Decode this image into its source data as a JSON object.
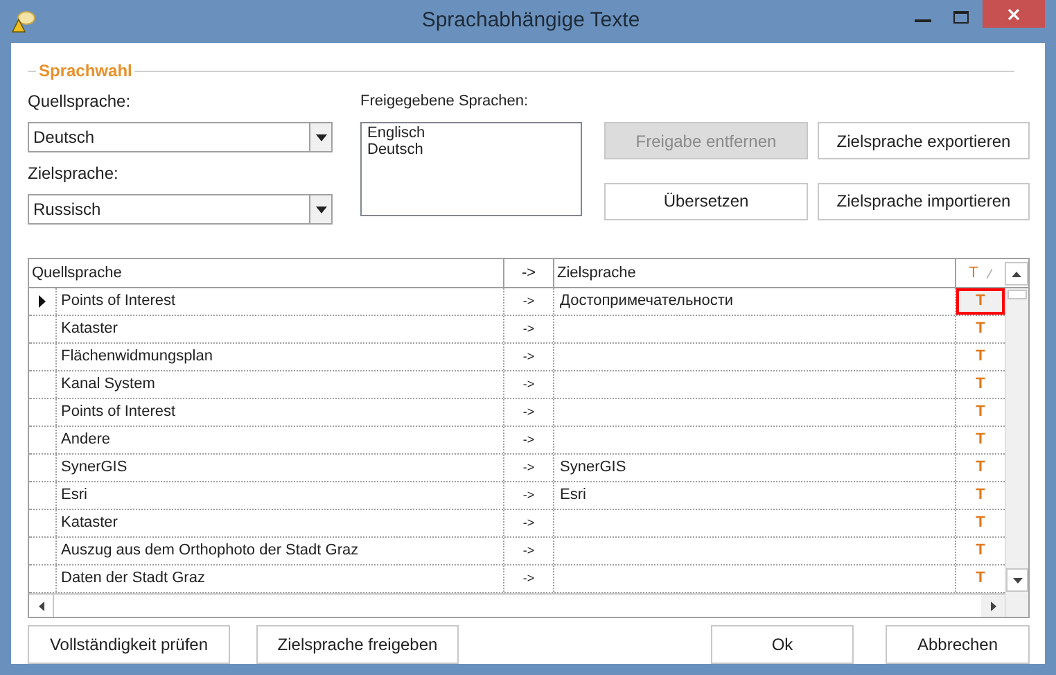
{
  "window": {
    "title": "Sprachabhängige Texte"
  },
  "group": {
    "title": "Sprachwahl"
  },
  "source_language": {
    "label": "Quellsprache:",
    "value": "Deutsch"
  },
  "target_language": {
    "label": "Zielsprache:",
    "value": "Russisch"
  },
  "released_languages": {
    "label": "Freigegebene Sprachen:",
    "items": [
      "Englisch",
      "Deutsch"
    ]
  },
  "action_buttons": [
    {
      "label": "Freigabe entfernen",
      "disabled": true
    },
    {
      "label": "Zielsprache exportieren",
      "disabled": false
    },
    {
      "label": "Übersetzen",
      "disabled": false
    },
    {
      "label": "Zielsprache importieren",
      "disabled": false
    }
  ],
  "table": {
    "columns": [
      "Quellsprache",
      "->",
      "Zielsprache",
      "T"
    ],
    "rows": [
      {
        "source": "Points of Interest",
        "arrow": "->",
        "target": "Достопримечательности",
        "t": "T",
        "selected": true
      },
      {
        "source": "Kataster",
        "arrow": "->",
        "target": "",
        "t": "T",
        "selected": false
      },
      {
        "source": "Flächenwidmungsplan",
        "arrow": "->",
        "target": "",
        "t": "T",
        "selected": false
      },
      {
        "source": "Kanal System",
        "arrow": "->",
        "target": "",
        "t": "T",
        "selected": false
      },
      {
        "source": "Points of Interest",
        "arrow": "->",
        "target": "",
        "t": "T",
        "selected": false
      },
      {
        "source": "Andere",
        "arrow": "->",
        "target": "",
        "t": "T",
        "selected": false
      },
      {
        "source": "SynerGIS",
        "arrow": "->",
        "target": "SynerGIS",
        "t": "T",
        "selected": false
      },
      {
        "source": "Esri",
        "arrow": "->",
        "target": "Esri",
        "t": "T",
        "selected": false
      },
      {
        "source": "Kataster",
        "arrow": "->",
        "target": "",
        "t": "T",
        "selected": false
      },
      {
        "source": "Auszug aus dem Orthophoto der Stadt Graz",
        "arrow": "->",
        "target": "",
        "t": "T",
        "selected": false
      },
      {
        "source": "Daten der Stadt Graz",
        "arrow": "->",
        "target": "",
        "t": "T",
        "selected": false
      }
    ]
  },
  "footer_buttons": [
    "Vollständigkeit prüfen",
    "Zielsprache freigeben",
    "Ok",
    "Abbrechen"
  ]
}
